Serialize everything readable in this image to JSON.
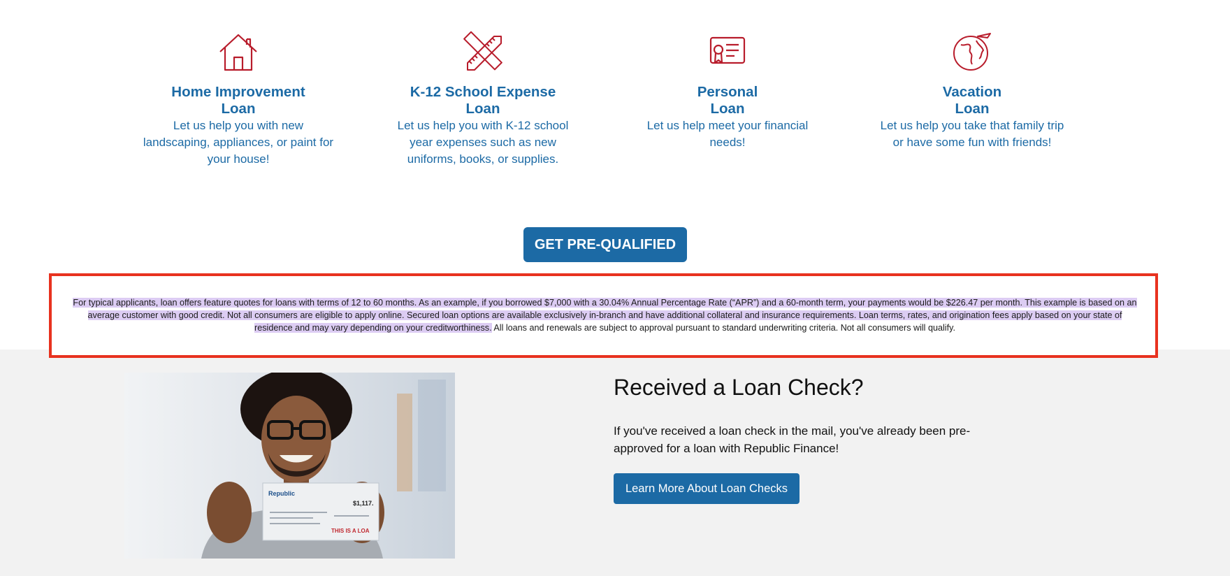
{
  "loans": [
    {
      "title_line1": "Home Improvement",
      "title_line2": "Loan",
      "description": "Let us help you with new landscaping, appliances, or paint for your house!",
      "icon": "house-icon"
    },
    {
      "title_line1": "K-12 School Expense",
      "title_line2": "Loan",
      "description": "Let us help you with K-12 school year expenses such as new uniforms, books, or supplies.",
      "icon": "pencil-ruler-icon"
    },
    {
      "title_line1": "Personal",
      "title_line2": "Loan",
      "description": "Let us help meet your financial needs!",
      "icon": "certificate-icon"
    },
    {
      "title_line1": "Vacation",
      "title_line2": "Loan",
      "description": "Let us help you take that family trip or have some fun with friends!",
      "icon": "globe-plane-icon"
    }
  ],
  "cta": {
    "label": "GET PRE-QUALIFIED"
  },
  "disclaimer": {
    "highlighted": "For typical applicants, loan offers feature quotes for loans with terms of 12 to 60 months. As an example, if you borrowed $7,000 with a 30.04% Annual Percentage Rate (“APR”) and a 60-month term, your payments would be $226.47 per month. This example is based on an average customer with good credit. Not all consumers are eligible to apply online. Secured loan options are available exclusively in-branch and have additional collateral and insurance requirements. Loan terms, rates, and origination fees apply based on your state of residence and may vary depending on your creditworthiness.",
    "plain": " All loans and renewals are subject to approval pursuant to standard underwriting criteria. Not all consumers will qualify."
  },
  "check_section": {
    "title": "Received a Loan Check?",
    "description": "If you've received a loan check in the mail, you've already been pre-approved for a loan with Republic Finance!",
    "button_label": "Learn More About Loan Checks"
  },
  "photo_check": {
    "brand": "Republic",
    "amount": "$1,117.",
    "stamp": "THIS IS A LOA"
  },
  "colors": {
    "accent": "#1c6aa5",
    "icon_red": "#b81c2b",
    "highlight": "#dcccf3",
    "annotation_border": "#e8321f"
  }
}
